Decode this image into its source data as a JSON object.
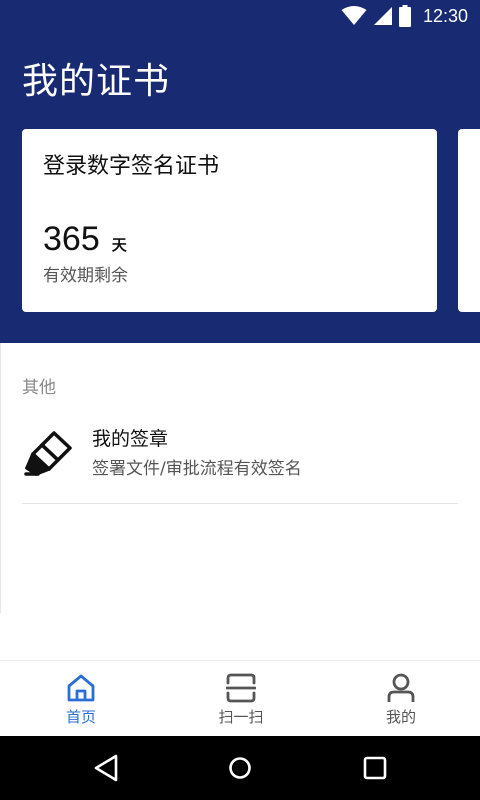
{
  "status_bar": {
    "time": "12:30",
    "icons": [
      "wifi-icon",
      "cellular-signal-icon",
      "battery-icon"
    ]
  },
  "header": {
    "title": "我的证书",
    "background_color": "#172a72"
  },
  "cert_card": {
    "title": "登录数字签名证书",
    "days_value": "365",
    "days_unit": "天",
    "subtitle": "有效期剩余"
  },
  "section": {
    "label": "其他"
  },
  "list_items": [
    {
      "icon": "seal-stamp-icon",
      "title": "我的签章",
      "subtitle": "签署文件/审批流程有效签名"
    }
  ],
  "bottom_nav": {
    "active_color": "#2a6fd6",
    "inactive_color": "#555555",
    "tabs": [
      {
        "label": "首页",
        "icon": "home-icon",
        "active": true
      },
      {
        "label": "扫一扫",
        "icon": "scan-icon",
        "active": false
      },
      {
        "label": "我的",
        "icon": "user-icon",
        "active": false
      }
    ]
  },
  "system_nav": {
    "icons": [
      "back-icon",
      "home-circle-icon",
      "recent-apps-icon"
    ]
  }
}
